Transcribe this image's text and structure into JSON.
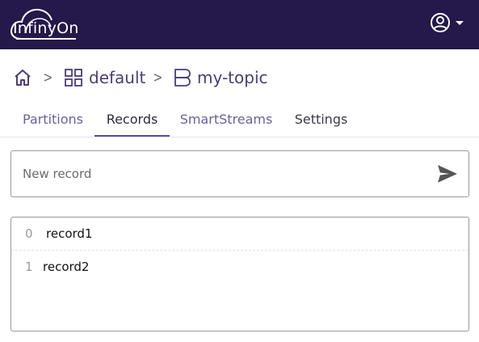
{
  "header": {
    "logo_text": "InfinyOn",
    "logo_icon": "cloud-logo-icon",
    "user_icon": "user-circle-icon",
    "menu_icon": "caret-down-icon",
    "background": "#25184a"
  },
  "breadcrumb": {
    "home_icon": "home-icon",
    "separator": ">",
    "items": [
      {
        "label": "default",
        "icon": "grid-icon"
      },
      {
        "label": "my-topic",
        "icon": "topic-icon"
      }
    ]
  },
  "tabs": [
    {
      "label": "Partitions",
      "active": false
    },
    {
      "label": "Records",
      "active": true
    },
    {
      "label": "SmartStreams",
      "active": false
    },
    {
      "label": "Settings",
      "active": false
    }
  ],
  "record_input": {
    "placeholder": "New record",
    "value": "",
    "send_icon": "send-icon"
  },
  "records": [
    {
      "offset": "0",
      "value": "record1"
    },
    {
      "offset": "1",
      "value": "record2"
    }
  ],
  "colors": {
    "accent": "#5b4f9e",
    "link": "#4a3d7a"
  }
}
